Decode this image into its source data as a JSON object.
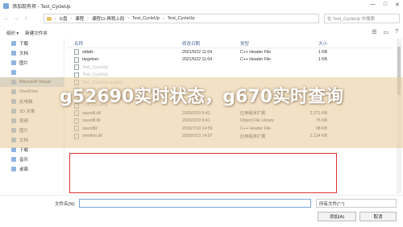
{
  "window": {
    "title": "添加现有项 - Test_CycleUp",
    "minimize_glyph": "—",
    "maximize_glyph": "□",
    "close_glyph": "✕"
  },
  "nav": {
    "back_glyph": "←",
    "forward_glyph": "→",
    "up_glyph": "↑",
    "breadcrumbs": [
      "G盘",
      "课程",
      "课程11-再稍上段",
      "Test_CycleUp",
      "Test_CycleUp"
    ],
    "search_placeholder": "在 Test_CycleUp 中搜索"
  },
  "toolbar": {
    "organize": "组织 ▾",
    "new_folder": "新建文件夹"
  },
  "sidebar": {
    "items": [
      {
        "label": "下载",
        "selected": false
      },
      {
        "label": "文档",
        "selected": false
      },
      {
        "label": "图片",
        "selected": false
      },
      {
        "label": "",
        "selected": false
      },
      {
        "label": "Microsoft Visual",
        "selected": true
      },
      {
        "label": "OneDrive",
        "selected": false
      },
      {
        "label": "此电脑",
        "selected": false
      },
      {
        "label": "3D 对象",
        "selected": false
      },
      {
        "label": "视频",
        "selected": false
      },
      {
        "label": "图片",
        "selected": false
      },
      {
        "label": "文档",
        "selected": false
      },
      {
        "label": "下载",
        "selected": false
      },
      {
        "label": "音乐",
        "selected": false
      },
      {
        "label": "桌面",
        "selected": false
      }
    ]
  },
  "columns": {
    "name": "名称",
    "date": "修改日期",
    "type": "类型",
    "size": "大小"
  },
  "files": [
    {
      "name": "stdafx",
      "date": "2021/5/22 11:04",
      "type": "C++ Header File",
      "size": "1 KB",
      "kind": "file",
      "faded": false
    },
    {
      "name": "targetver",
      "date": "2021/5/22 11:04",
      "type": "C++ Header File",
      "size": "1 KB",
      "kind": "file",
      "faded": false
    },
    {
      "name": "Test_CycleUp",
      "date": "",
      "type": "",
      "size": "",
      "kind": "file",
      "faded": true
    },
    {
      "name": "Test_CycleUp",
      "date": "",
      "type": "",
      "size": "",
      "kind": "file",
      "faded": true
    },
    {
      "name": "Test_CycleUp.vcxproj",
      "date": "",
      "type": "",
      "size": "",
      "kind": "file",
      "faded": true
    },
    {
      "name": "Test_CycleUp.vcxproj.filters",
      "date": "",
      "type": "",
      "size": "",
      "kind": "file",
      "faded": true
    },
    {
      "name": "Test_CycleUp.vcxproj.user",
      "date": "",
      "type": "",
      "size": "",
      "kind": "file",
      "faded": true
    },
    {
      "name": "Test_CycleUp",
      "date": "",
      "type": "",
      "size": "",
      "kind": "file",
      "faded": true
    },
    {
      "name": "zauxdll.dll",
      "date": "2020/2/19 9:41",
      "type": "应用程序扩展",
      "size": "2,271 KB",
      "kind": "file",
      "faded": false
    },
    {
      "name": "zauxdll.lib",
      "date": "2020/2/19 9:41",
      "type": "Object File Library",
      "size": "75 KB",
      "kind": "file",
      "faded": false
    },
    {
      "name": "zauxdll2",
      "date": "2019/7/18 14:59",
      "type": "C++ Header File",
      "size": "98 KB",
      "kind": "file",
      "faded": false
    },
    {
      "name": "zmotion.dll",
      "date": "2020/1/13 14:07",
      "type": "应用程序扩展",
      "size": "2,134 KB",
      "kind": "file",
      "faded": false
    }
  ],
  "bottom": {
    "filename_label": "文件名(N):",
    "filename_value": "",
    "filter": "所有文件(*.*)",
    "open_button": "添加(A)",
    "cancel_button": "取消"
  },
  "overlay": {
    "text": "g52690实时状态，g670实时查询"
  },
  "colors": {
    "accent": "#7aa6d8",
    "highlight_border": "#d33333",
    "banner": "#e8c896"
  }
}
